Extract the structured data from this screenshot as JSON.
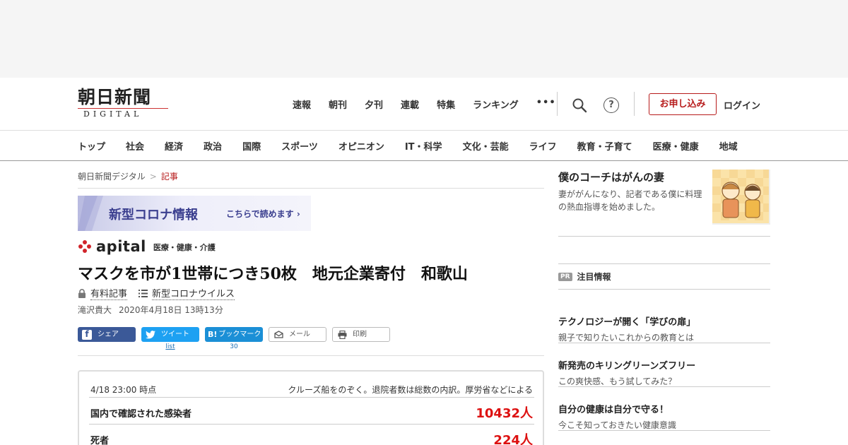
{
  "logo": {
    "main": "朝日新聞",
    "sub": "DIGITAL"
  },
  "topnav": [
    "速報",
    "朝刊",
    "夕刊",
    "連載",
    "特集",
    "ランキング"
  ],
  "topnav_more": "•••",
  "header_actions": {
    "help": "?",
    "subscribe": "お申し込み",
    "login": "ログイン"
  },
  "genre_nav": [
    "トップ",
    "社会",
    "経済",
    "政治",
    "国際",
    "スポーツ",
    "オピニオン",
    "IT・科学",
    "文化・芸能",
    "ライフ",
    "教育・子育て",
    "医療・健康",
    "地域"
  ],
  "breadcrumb": {
    "home": "朝日新聞デジタル",
    "sep": ">",
    "current": "記事"
  },
  "banner": {
    "title": "新型コロナ情報",
    "link": "こちらで読めます ›"
  },
  "apital": {
    "logo": "apital",
    "category": "医療・健康・介護"
  },
  "article": {
    "headline": "マスクを市が1世帯につき50枚　地元企業寄付　和歌山",
    "paid_label": "有料記事",
    "topic_label": "新型コロナウイルス",
    "author": "滝沢貴大",
    "date": "2020年4月18日 13時13分"
  },
  "share": {
    "facebook": "シェア",
    "twitter": "ツイート",
    "hatena_icon": "B!",
    "hatena": "ブックマーク",
    "mail": "メール",
    "print": "印刷",
    "twitter_count": "list",
    "hatena_count": "30"
  },
  "covid_stats": {
    "timestamp": "4/18 23:00 時点",
    "note": "クルーズ船をのぞく。退院者数は総数の内訳。厚労省などによる",
    "rows": [
      {
        "label": "国内で確認された感染者",
        "value": "10432人"
      },
      {
        "label": "死者",
        "value": "224人"
      }
    ]
  },
  "sidebar": {
    "feature": {
      "title": "僕のコーチはがんの妻",
      "desc": "妻ががんになり、記者である僕に料理の熱血指導を始めました。"
    },
    "pr_badge": "PR",
    "pr_label": "注目情報",
    "pr_items": [
      {
        "title": "テクノロジーが開く「学びの扉」",
        "desc": "親子で知りたいこれからの教育とは"
      },
      {
        "title": "新発売のキリングリーンズフリー",
        "desc": "この爽快感、もう試してみた？"
      },
      {
        "title": "自分の健康は自分で守る！",
        "desc": "今こそ知っておきたい健康意識"
      }
    ]
  },
  "colors": {
    "accent_red": "#b71b1b",
    "stat_red": "#dd1111",
    "facebook": "#3b5998",
    "twitter": "#1da1f2",
    "hatena": "#1b8fd6",
    "banner_text": "#3b3f8f"
  }
}
